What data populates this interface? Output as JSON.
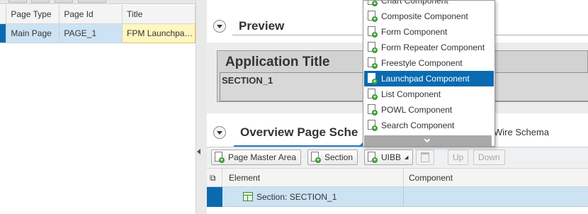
{
  "left_table": {
    "columns": [
      "Page Type",
      "Page Id",
      "Title"
    ],
    "rows": [
      {
        "page_type": "Main Page",
        "page_id": "PAGE_1",
        "title": "FPM Launchpad Application"
      }
    ]
  },
  "preview": {
    "heading": "Preview",
    "app_title": "Application Title",
    "section": "SECTION_1"
  },
  "overview": {
    "heading": "Overview Page Sche",
    "wire_schema": "Wire Schema"
  },
  "toolbar": {
    "page_master_area": "Page Master Area",
    "section": "Section",
    "uibb": "UIBB",
    "up": "Up",
    "down": "Down"
  },
  "grid": {
    "columns": [
      "Element",
      "Component"
    ],
    "rows": [
      {
        "element": "Section: SECTION_1",
        "component": ""
      }
    ]
  },
  "dropdown": {
    "items": [
      {
        "label": "Chart Component",
        "selected": false
      },
      {
        "label": "Composite Component",
        "selected": false
      },
      {
        "label": "Form Component",
        "selected": false
      },
      {
        "label": "Form Repeater Component",
        "selected": false
      },
      {
        "label": "Freestyle Component",
        "selected": false
      },
      {
        "label": "Launchpad Component",
        "selected": true
      },
      {
        "label": "List Component",
        "selected": false
      },
      {
        "label": "POWL Component",
        "selected": false
      },
      {
        "label": "Search Component",
        "selected": false
      }
    ]
  },
  "colors": {
    "selection_blue": "#0a6ab0",
    "row_highlight": "#cde3f3",
    "add_green": "#3d9b35",
    "title_cell_yellow": "#fff6c0"
  }
}
